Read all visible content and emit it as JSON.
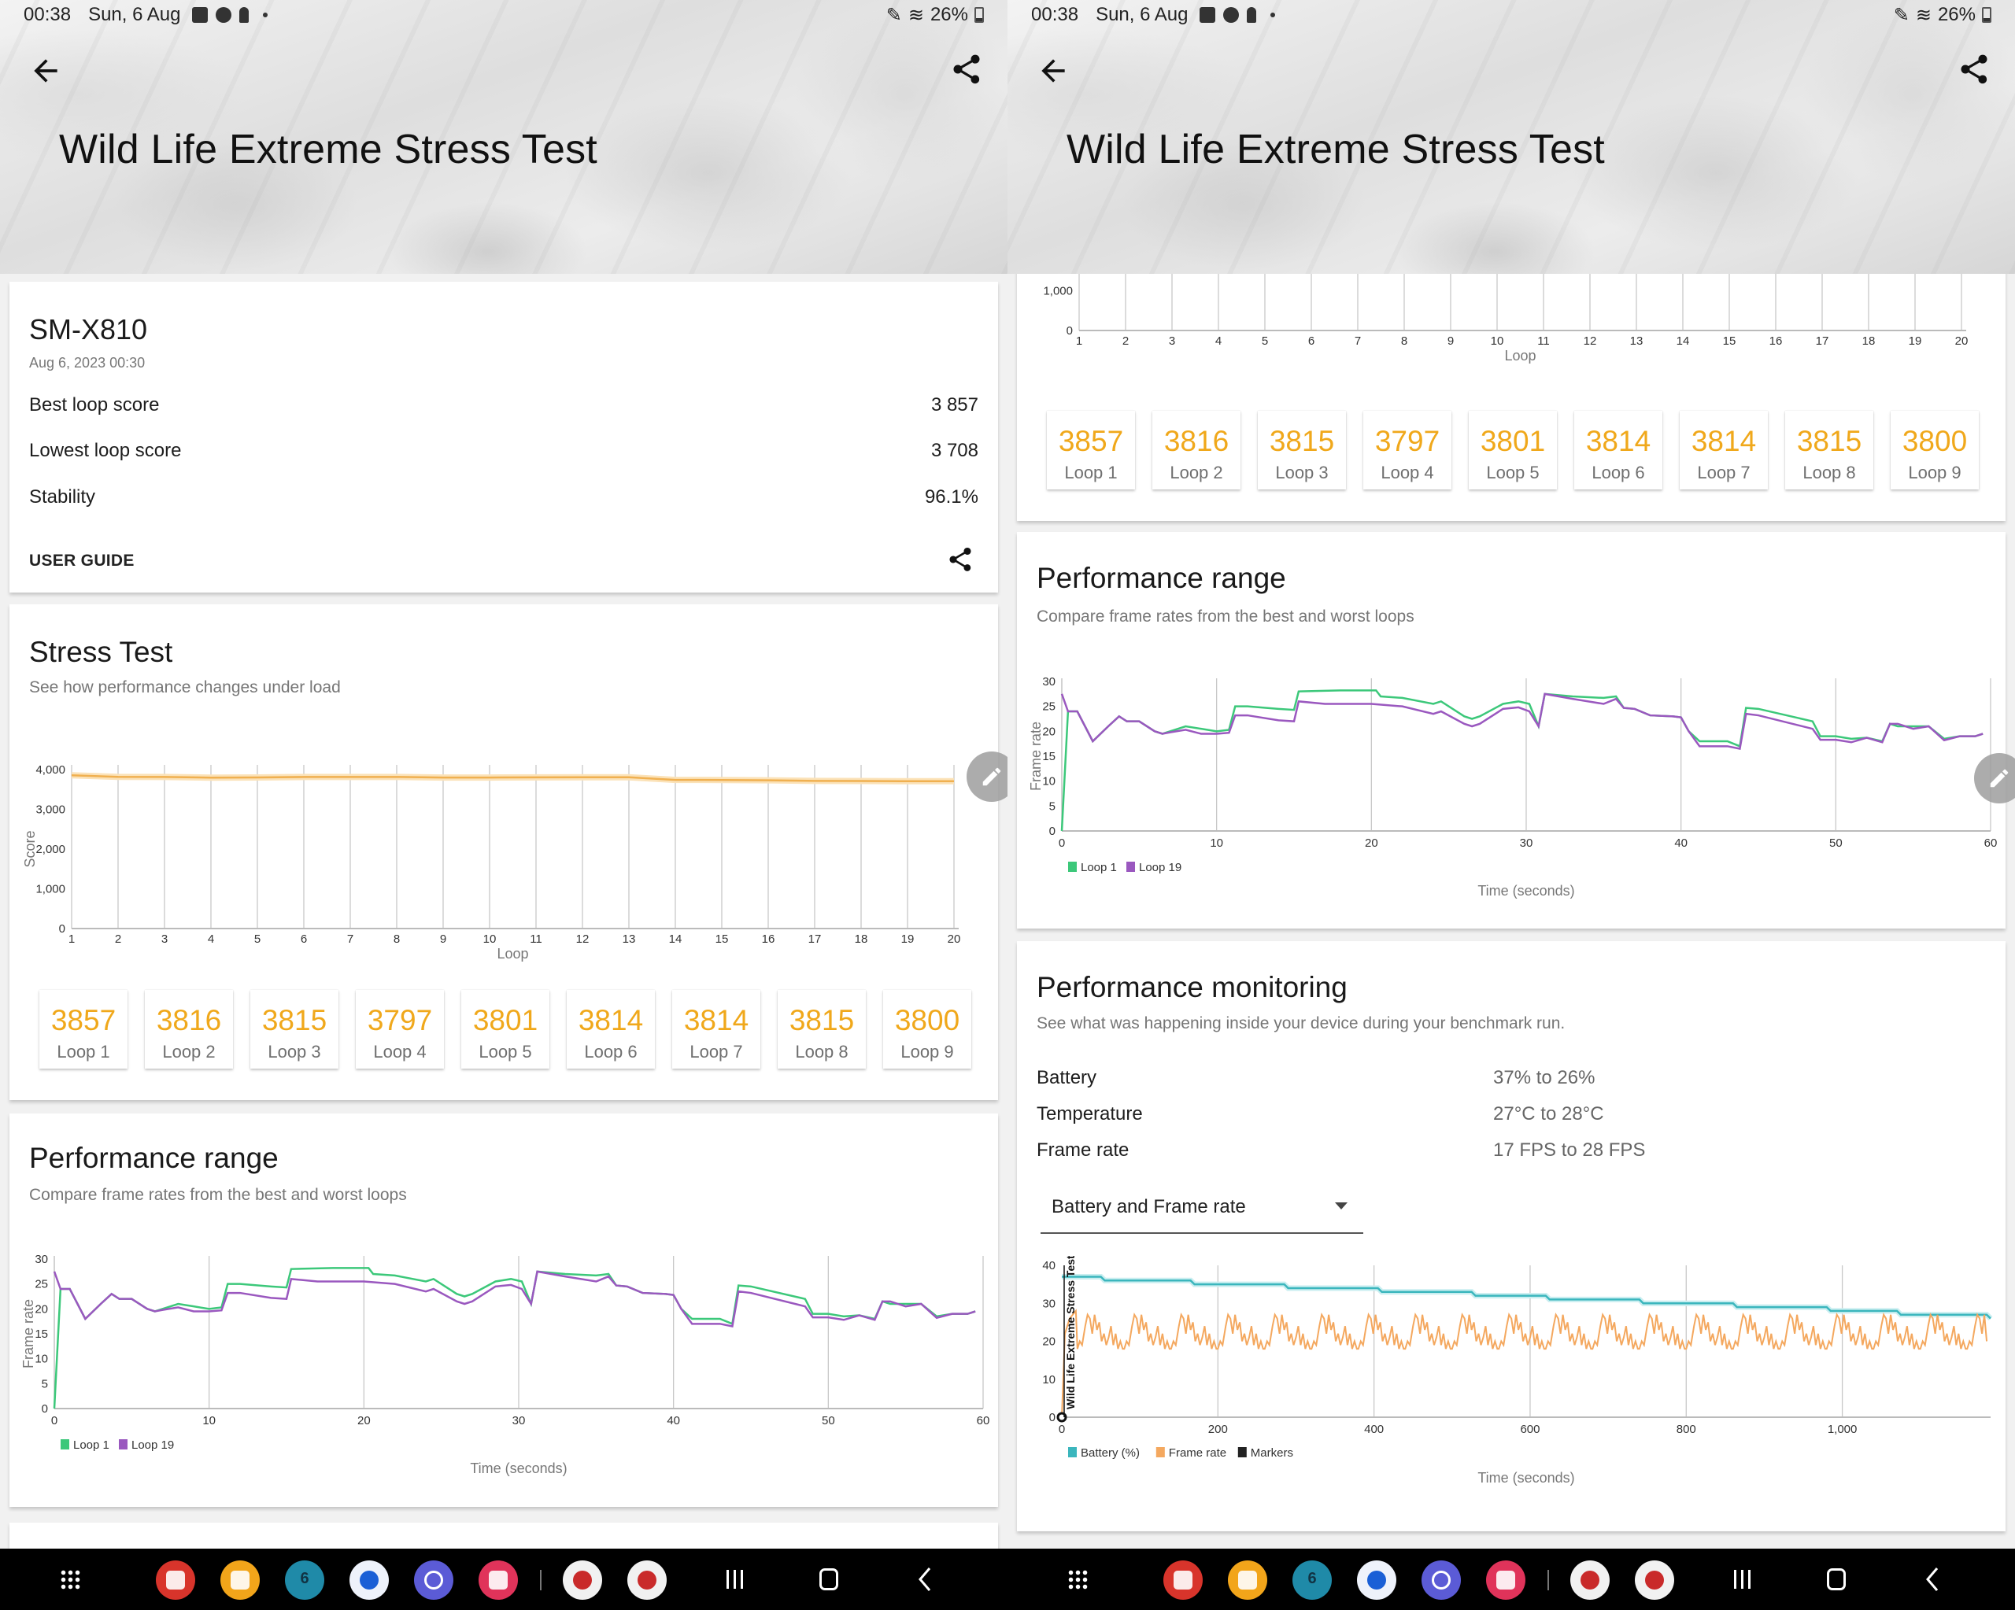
{
  "status_bar": {
    "time": "00:38",
    "date": "Sun, 6 Aug",
    "battery": "26%"
  },
  "header": {
    "title": "Wild Life Extreme Stress Test",
    "back_icon": "arrow-left-icon",
    "share_icon": "share-icon"
  },
  "summary": {
    "device": "SM-X810",
    "date": "Aug 6, 2023 00:30",
    "rows": [
      {
        "label": "Best loop score",
        "value": "3 857"
      },
      {
        "label": "Lowest loop score",
        "value": "3 708"
      },
      {
        "label": "Stability",
        "value": "96.1%"
      }
    ],
    "user_guide": "USER GUIDE"
  },
  "stress_test": {
    "title": "Stress Test",
    "subtitle": "See how performance changes under load",
    "loops": [
      {
        "score": "3857",
        "label": "Loop 1"
      },
      {
        "score": "3816",
        "label": "Loop 2"
      },
      {
        "score": "3815",
        "label": "Loop 3"
      },
      {
        "score": "3797",
        "label": "Loop 4"
      },
      {
        "score": "3801",
        "label": "Loop 5"
      },
      {
        "score": "3814",
        "label": "Loop 6"
      },
      {
        "score": "3814",
        "label": "Loop 7"
      },
      {
        "score": "3815",
        "label": "Loop 8"
      },
      {
        "score": "3800",
        "label": "Loop 9"
      }
    ]
  },
  "performance_range": {
    "title": "Performance range",
    "subtitle": "Compare frame rates from the best and worst loops"
  },
  "performance_monitoring": {
    "title": "Performance monitoring",
    "subtitle": "See what was happening inside your device during your benchmark run.",
    "rows": [
      {
        "label": "Battery",
        "value": "37% to 26%"
      },
      {
        "label": "Temperature",
        "value": "27°C to 28°C"
      },
      {
        "label": "Frame rate",
        "value": "17 FPS to 28 FPS"
      }
    ],
    "dropdown_selected": "Battery and Frame rate"
  },
  "nav_bar": {
    "apps": [
      {
        "name": "app-red-icon",
        "color": "#d8342b"
      },
      {
        "name": "my-files-icon",
        "color": "#f2a51a"
      },
      {
        "name": "calendar-icon",
        "color": "#1f8aa8",
        "text": "6"
      },
      {
        "name": "messages-icon",
        "color": "#eef2fb"
      },
      {
        "name": "internet-browser-icon",
        "color": "#5b5bd6"
      },
      {
        "name": "screen-recorder-icon",
        "color": "#e0335a"
      },
      {
        "name": "antutu-icon",
        "color": "#f1f1f1"
      },
      {
        "name": "antutu-3d-icon",
        "color": "#f1f1f1"
      }
    ]
  },
  "chart_data": [
    {
      "id": "stress_test_chart",
      "type": "line",
      "title": "",
      "xlabel": "Loop",
      "ylabel": "Score",
      "x": [
        1,
        2,
        3,
        4,
        5,
        6,
        7,
        8,
        9,
        10,
        11,
        12,
        13,
        14,
        15,
        16,
        17,
        18,
        19,
        20
      ],
      "series": [
        {
          "name": "Score",
          "color": "#f0b050",
          "values": [
            3857,
            3816,
            3815,
            3797,
            3801,
            3814,
            3814,
            3815,
            3800,
            3800,
            3805,
            3808,
            3806,
            3740,
            3738,
            3730,
            3715,
            3712,
            3708,
            3708
          ]
        }
      ],
      "ylim": [
        0,
        4000
      ],
      "yticks": [
        0,
        1000,
        2000,
        3000,
        4000
      ],
      "ytick_labels": [
        "0",
        "1,000",
        "2,000",
        "3,000",
        "4,000"
      ],
      "grid": "vertical"
    },
    {
      "id": "performance_range_chart",
      "type": "line",
      "xlabel": "Time (seconds)",
      "ylabel": "Frame rate",
      "xlim": [
        0,
        60
      ],
      "ylim": [
        0,
        30
      ],
      "xticks": [
        0,
        10,
        20,
        30,
        40,
        50,
        60
      ],
      "yticks": [
        0,
        5,
        10,
        15,
        20,
        25,
        30
      ],
      "legend": "bottom-left",
      "series": [
        {
          "name": "Loop 1",
          "color": "#3cc87a",
          "points": [
            [
              0,
              0
            ],
            [
              0.4,
              24
            ],
            [
              1,
              24
            ],
            [
              1.5,
              21
            ],
            [
              2,
              18
            ],
            [
              3,
              21
            ],
            [
              3.7,
              23
            ],
            [
              4.2,
              22
            ],
            [
              5,
              22
            ],
            [
              6,
              20
            ],
            [
              6.5,
              19.5
            ],
            [
              7,
              20
            ],
            [
              8,
              21
            ],
            [
              9,
              20.5
            ],
            [
              10,
              20
            ],
            [
              10.8,
              20.3
            ],
            [
              11.2,
              25
            ],
            [
              12,
              25
            ],
            [
              14,
              24.5
            ],
            [
              15,
              24.3
            ],
            [
              15.3,
              28
            ],
            [
              18,
              28.2
            ],
            [
              20.3,
              28.2
            ],
            [
              20.6,
              27
            ],
            [
              22,
              26.7
            ],
            [
              24,
              25.5
            ],
            [
              24.5,
              26
            ],
            [
              26,
              23
            ],
            [
              26.5,
              22.5
            ],
            [
              27,
              23
            ],
            [
              28.5,
              25.5
            ],
            [
              29.5,
              26
            ],
            [
              30.2,
              25.5
            ],
            [
              30.8,
              21
            ],
            [
              31.2,
              27.5
            ],
            [
              33,
              27
            ],
            [
              35,
              26.7
            ],
            [
              35.8,
              27
            ],
            [
              36.3,
              24.7
            ],
            [
              37,
              24.5
            ],
            [
              38,
              23.2
            ],
            [
              39.5,
              23
            ],
            [
              40,
              22.8
            ],
            [
              40.5,
              20
            ],
            [
              41.2,
              18
            ],
            [
              43,
              18
            ],
            [
              43.8,
              17
            ],
            [
              44.2,
              24.7
            ],
            [
              45,
              24.5
            ],
            [
              48.5,
              22
            ],
            [
              49,
              19
            ],
            [
              50,
              19
            ],
            [
              51,
              18.5
            ],
            [
              52,
              18.7
            ],
            [
              53,
              18
            ],
            [
              53.5,
              21.5
            ],
            [
              54,
              21
            ],
            [
              55,
              21
            ],
            [
              56,
              21
            ],
            [
              57,
              18.5
            ],
            [
              58,
              19
            ],
            [
              59,
              19
            ],
            [
              59.5,
              19.5
            ]
          ]
        },
        {
          "name": "Loop 19",
          "color": "#9a58bf",
          "points": [
            [
              0,
              27.5
            ],
            [
              0.4,
              24
            ],
            [
              1,
              24
            ],
            [
              1.5,
              21
            ],
            [
              2,
              18
            ],
            [
              3,
              21
            ],
            [
              3.7,
              23
            ],
            [
              4.2,
              22
            ],
            [
              5,
              22
            ],
            [
              6,
              20
            ],
            [
              6.5,
              19.5
            ],
            [
              7,
              19.8
            ],
            [
              8,
              20.3
            ],
            [
              9,
              19.5
            ],
            [
              10,
              19.5
            ],
            [
              10.8,
              19.7
            ],
            [
              11.2,
              23.2
            ],
            [
              12,
              23.2
            ],
            [
              14,
              22.2
            ],
            [
              15,
              22
            ],
            [
              15.3,
              26
            ],
            [
              17,
              25.5
            ],
            [
              20,
              25.5
            ],
            [
              22,
              25
            ],
            [
              24,
              23.5
            ],
            [
              24.5,
              24
            ],
            [
              26,
              21.5
            ],
            [
              26.5,
              21
            ],
            [
              27,
              21.5
            ],
            [
              28.5,
              24.5
            ],
            [
              29.5,
              24.8
            ],
            [
              30.2,
              24
            ],
            [
              30.8,
              21
            ],
            [
              31.2,
              27.5
            ],
            [
              33,
              26.5
            ],
            [
              35,
              25.5
            ],
            [
              35.8,
              26.5
            ],
            [
              36.3,
              24.7
            ],
            [
              37,
              24.5
            ],
            [
              38,
              23.2
            ],
            [
              39.5,
              23
            ],
            [
              40,
              22.8
            ],
            [
              40.5,
              20
            ],
            [
              41.2,
              17
            ],
            [
              43,
              17
            ],
            [
              43.8,
              16.5
            ],
            [
              44.2,
              23.5
            ],
            [
              45,
              23.2
            ],
            [
              48.5,
              20.5
            ],
            [
              49,
              18.3
            ],
            [
              50,
              18.3
            ],
            [
              51,
              17.8
            ],
            [
              52,
              18.7
            ],
            [
              53,
              17.8
            ],
            [
              53.5,
              21.5
            ],
            [
              54,
              21.5
            ],
            [
              55,
              20.5
            ],
            [
              56,
              21
            ],
            [
              57,
              18.2
            ],
            [
              58,
              19
            ],
            [
              59,
              19
            ],
            [
              59.5,
              19.5
            ]
          ]
        }
      ]
    },
    {
      "id": "performance_monitoring_chart",
      "type": "line",
      "xlabel": "Time (seconds)",
      "xlim": [
        0,
        1190
      ],
      "ylim": [
        0,
        40
      ],
      "xticks": [
        0,
        200,
        400,
        600,
        800,
        1000
      ],
      "xtick_labels": [
        "0",
        "200",
        "400",
        "600",
        "800",
        "1,000"
      ],
      "yticks": [
        0,
        10,
        20,
        30,
        40
      ],
      "legend": "bottom-left",
      "annotations": [
        {
          "x": 0,
          "text": "Wild Life Extreme Stress Test"
        }
      ],
      "series": [
        {
          "name": "Battery (%)",
          "color": "#3bb6bd",
          "steps": [
            [
              0,
              37
            ],
            [
              50,
              36
            ],
            [
              165,
              35
            ],
            [
              285,
              34
            ],
            [
              405,
              33
            ],
            [
              525,
              32
            ],
            [
              620,
              31
            ],
            [
              740,
              30
            ],
            [
              860,
              29
            ],
            [
              980,
              28
            ],
            [
              1070,
              27
            ],
            [
              1185,
              26
            ]
          ]
        },
        {
          "name": "Frame rate",
          "color": "#f4a85f",
          "loop_period_seconds": 60,
          "min": 17,
          "max": 28
        },
        {
          "name": "Markers",
          "color": "#222222"
        }
      ]
    }
  ]
}
